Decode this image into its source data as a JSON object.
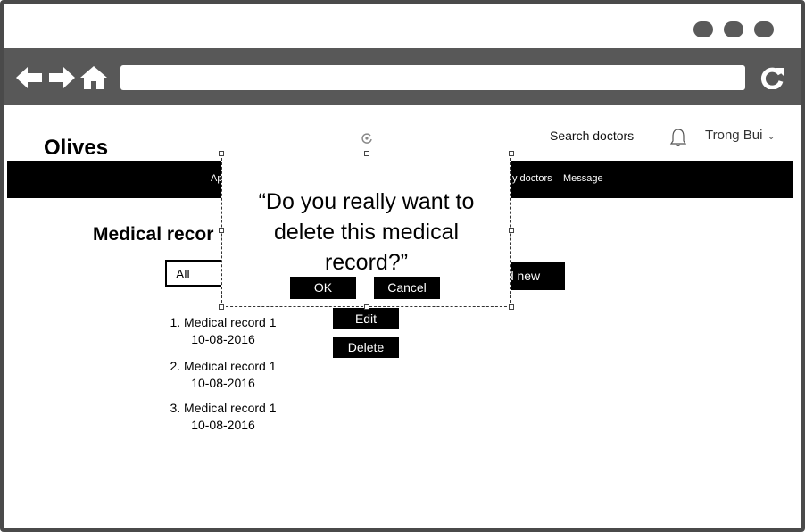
{
  "header": {
    "logo": "Olives",
    "search_link": "Search doctors",
    "user_name": "Trong Bui"
  },
  "nav": {
    "item_partial_left": "Ap",
    "item_partial_doctors": "y doctors",
    "item_message": "Message"
  },
  "main": {
    "title": "Medical recor",
    "filter_value": "All",
    "add_button_partial": "d new",
    "records": [
      {
        "name": "1. Medical record 1",
        "date": "10-08-2016"
      },
      {
        "name": "2. Medical record 1",
        "date": "10-08-2016"
      },
      {
        "name": "3. Medical record 1",
        "date": "10-08-2016"
      }
    ],
    "edit_label": "Edit",
    "delete_label": "Delete"
  },
  "dialog": {
    "line1": "“Do you really want to",
    "line2": "delete this medical",
    "line3": "record?”",
    "ok_label": "OK",
    "cancel_label": "Cancel"
  },
  "colors": {
    "browser_chrome": "#585858",
    "navbar": "#000000",
    "button": "#000000"
  }
}
